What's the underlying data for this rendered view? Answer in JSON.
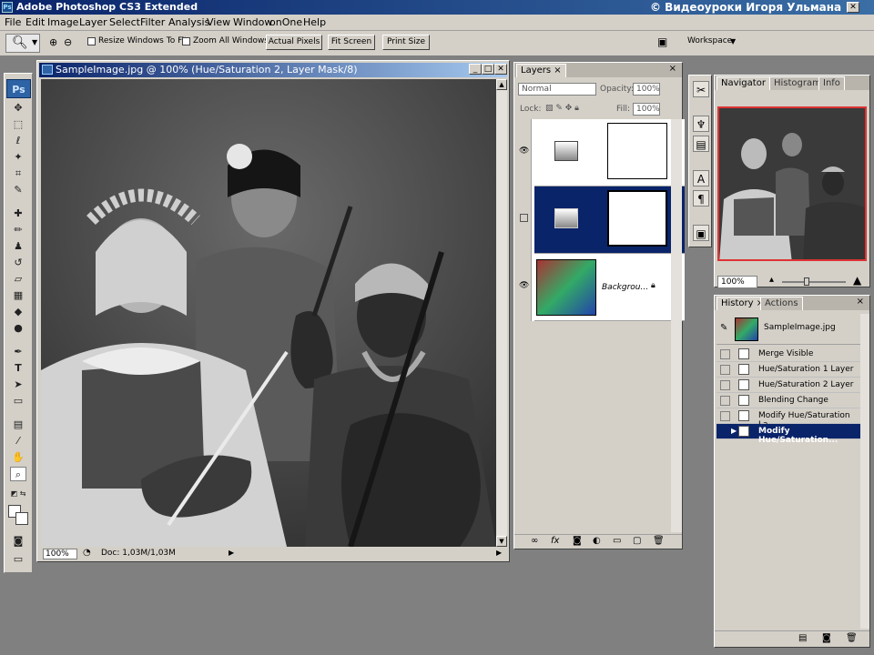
{
  "app": {
    "title": "Adobe Photoshop CS3 Extended",
    "watermark": "© Видеоуроки Игоря Ульмана"
  },
  "menu": [
    "File",
    "Edit",
    "Image",
    "Layer",
    "Select",
    "Filter",
    "Analysis",
    "View",
    "Window",
    "onOne",
    "Help"
  ],
  "options": {
    "resize_windows": "Resize Windows To Fit",
    "zoom_all": "Zoom All Windows",
    "actual_pixels": "Actual Pixels",
    "fit_screen": "Fit Screen",
    "print_size": "Print Size",
    "workspace": "Workspace"
  },
  "document": {
    "title": "SampleImage.jpg @ 100% (Hue/Saturation 2, Layer Mask/8)",
    "zoom": "100%",
    "doc_info": "Doc: 1,03M/1,03M"
  },
  "layers_panel": {
    "tab": "Layers",
    "blend_mode": "Normal",
    "opacity_label": "Opacity:",
    "opacity": "100%",
    "lock_label": "Lock:",
    "fill_label": "Fill:",
    "fill": "100%",
    "background_layer": "Backgrou..."
  },
  "navigator_panel": {
    "tabs": [
      "Navigator",
      "Histogram",
      "Info"
    ],
    "zoom": "100%"
  },
  "history_panel": {
    "tabs": [
      "History",
      "Actions"
    ],
    "snapshot": "SampleImage.jpg",
    "items": [
      "Merge Visible",
      "Hue/Saturation 1 Layer",
      "Hue/Saturation 2 Layer",
      "Blending Change",
      "Modify Hue/Saturation La...",
      "Modify Hue/Saturation..."
    ]
  },
  "colors": {
    "title_blue": "#0a246a",
    "panel_gray": "#d4d0c8",
    "selection_blue": "#0a246a",
    "nav_frame": "#dd3333"
  }
}
